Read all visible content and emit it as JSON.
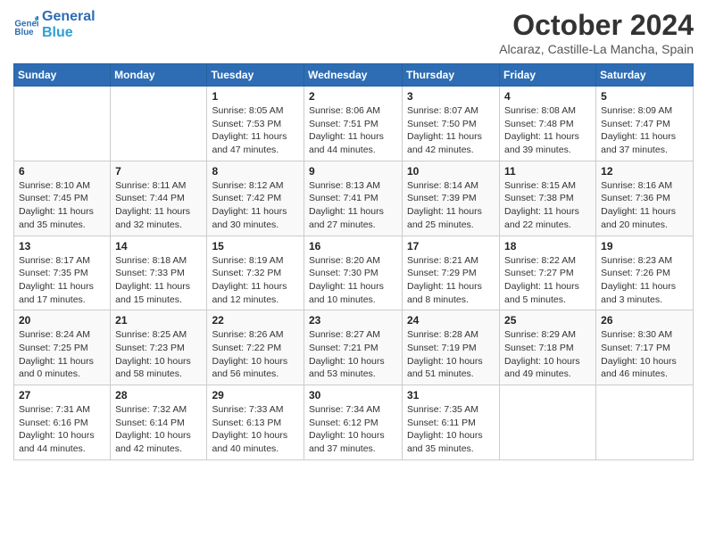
{
  "header": {
    "logo_line1": "General",
    "logo_line2": "Blue",
    "title": "October 2024",
    "subtitle": "Alcaraz, Castille-La Mancha, Spain"
  },
  "days_of_week": [
    "Sunday",
    "Monday",
    "Tuesday",
    "Wednesday",
    "Thursday",
    "Friday",
    "Saturday"
  ],
  "weeks": [
    [
      {
        "day": "",
        "info": ""
      },
      {
        "day": "",
        "info": ""
      },
      {
        "day": "1",
        "info": "Sunrise: 8:05 AM\nSunset: 7:53 PM\nDaylight: 11 hours and 47 minutes."
      },
      {
        "day": "2",
        "info": "Sunrise: 8:06 AM\nSunset: 7:51 PM\nDaylight: 11 hours and 44 minutes."
      },
      {
        "day": "3",
        "info": "Sunrise: 8:07 AM\nSunset: 7:50 PM\nDaylight: 11 hours and 42 minutes."
      },
      {
        "day": "4",
        "info": "Sunrise: 8:08 AM\nSunset: 7:48 PM\nDaylight: 11 hours and 39 minutes."
      },
      {
        "day": "5",
        "info": "Sunrise: 8:09 AM\nSunset: 7:47 PM\nDaylight: 11 hours and 37 minutes."
      }
    ],
    [
      {
        "day": "6",
        "info": "Sunrise: 8:10 AM\nSunset: 7:45 PM\nDaylight: 11 hours and 35 minutes."
      },
      {
        "day": "7",
        "info": "Sunrise: 8:11 AM\nSunset: 7:44 PM\nDaylight: 11 hours and 32 minutes."
      },
      {
        "day": "8",
        "info": "Sunrise: 8:12 AM\nSunset: 7:42 PM\nDaylight: 11 hours and 30 minutes."
      },
      {
        "day": "9",
        "info": "Sunrise: 8:13 AM\nSunset: 7:41 PM\nDaylight: 11 hours and 27 minutes."
      },
      {
        "day": "10",
        "info": "Sunrise: 8:14 AM\nSunset: 7:39 PM\nDaylight: 11 hours and 25 minutes."
      },
      {
        "day": "11",
        "info": "Sunrise: 8:15 AM\nSunset: 7:38 PM\nDaylight: 11 hours and 22 minutes."
      },
      {
        "day": "12",
        "info": "Sunrise: 8:16 AM\nSunset: 7:36 PM\nDaylight: 11 hours and 20 minutes."
      }
    ],
    [
      {
        "day": "13",
        "info": "Sunrise: 8:17 AM\nSunset: 7:35 PM\nDaylight: 11 hours and 17 minutes."
      },
      {
        "day": "14",
        "info": "Sunrise: 8:18 AM\nSunset: 7:33 PM\nDaylight: 11 hours and 15 minutes."
      },
      {
        "day": "15",
        "info": "Sunrise: 8:19 AM\nSunset: 7:32 PM\nDaylight: 11 hours and 12 minutes."
      },
      {
        "day": "16",
        "info": "Sunrise: 8:20 AM\nSunset: 7:30 PM\nDaylight: 11 hours and 10 minutes."
      },
      {
        "day": "17",
        "info": "Sunrise: 8:21 AM\nSunset: 7:29 PM\nDaylight: 11 hours and 8 minutes."
      },
      {
        "day": "18",
        "info": "Sunrise: 8:22 AM\nSunset: 7:27 PM\nDaylight: 11 hours and 5 minutes."
      },
      {
        "day": "19",
        "info": "Sunrise: 8:23 AM\nSunset: 7:26 PM\nDaylight: 11 hours and 3 minutes."
      }
    ],
    [
      {
        "day": "20",
        "info": "Sunrise: 8:24 AM\nSunset: 7:25 PM\nDaylight: 11 hours and 0 minutes."
      },
      {
        "day": "21",
        "info": "Sunrise: 8:25 AM\nSunset: 7:23 PM\nDaylight: 10 hours and 58 minutes."
      },
      {
        "day": "22",
        "info": "Sunrise: 8:26 AM\nSunset: 7:22 PM\nDaylight: 10 hours and 56 minutes."
      },
      {
        "day": "23",
        "info": "Sunrise: 8:27 AM\nSunset: 7:21 PM\nDaylight: 10 hours and 53 minutes."
      },
      {
        "day": "24",
        "info": "Sunrise: 8:28 AM\nSunset: 7:19 PM\nDaylight: 10 hours and 51 minutes."
      },
      {
        "day": "25",
        "info": "Sunrise: 8:29 AM\nSunset: 7:18 PM\nDaylight: 10 hours and 49 minutes."
      },
      {
        "day": "26",
        "info": "Sunrise: 8:30 AM\nSunset: 7:17 PM\nDaylight: 10 hours and 46 minutes."
      }
    ],
    [
      {
        "day": "27",
        "info": "Sunrise: 7:31 AM\nSunset: 6:16 PM\nDaylight: 10 hours and 44 minutes."
      },
      {
        "day": "28",
        "info": "Sunrise: 7:32 AM\nSunset: 6:14 PM\nDaylight: 10 hours and 42 minutes."
      },
      {
        "day": "29",
        "info": "Sunrise: 7:33 AM\nSunset: 6:13 PM\nDaylight: 10 hours and 40 minutes."
      },
      {
        "day": "30",
        "info": "Sunrise: 7:34 AM\nSunset: 6:12 PM\nDaylight: 10 hours and 37 minutes."
      },
      {
        "day": "31",
        "info": "Sunrise: 7:35 AM\nSunset: 6:11 PM\nDaylight: 10 hours and 35 minutes."
      },
      {
        "day": "",
        "info": ""
      },
      {
        "day": "",
        "info": ""
      }
    ]
  ]
}
